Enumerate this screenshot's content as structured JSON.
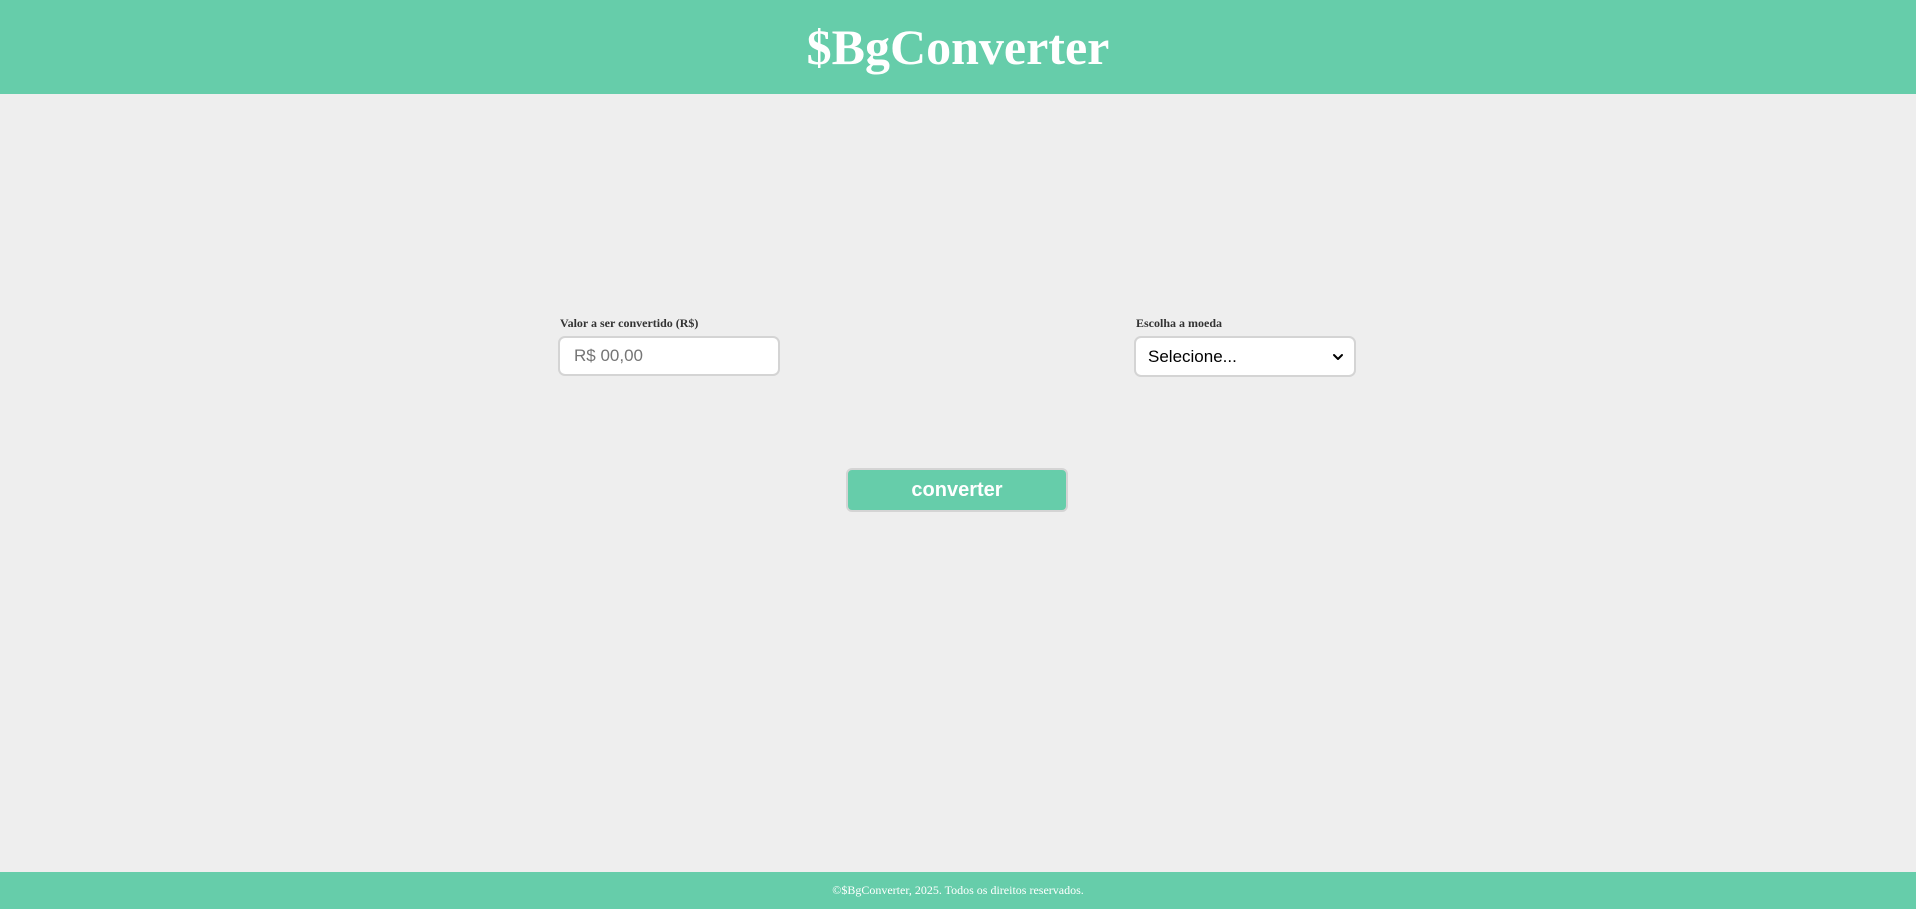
{
  "header": {
    "title": "$BgConverter"
  },
  "form": {
    "amount": {
      "label": "Valor a ser convertido (R$)",
      "value": "",
      "placeholder": "R$ 00,00"
    },
    "currency": {
      "label": "Escolha a moeda",
      "selected": "Selecione...",
      "icon": "chevron-down-icon"
    },
    "convert_label": "converter"
  },
  "footer": {
    "text": "©$BgConverter, 2025. Todos os direitos reservados."
  },
  "colors": {
    "accent": "#66cdaa",
    "background": "#eeeeee",
    "text_on_accent": "#ffffff",
    "label_text": "#333333",
    "border": "#d4d4d4"
  }
}
